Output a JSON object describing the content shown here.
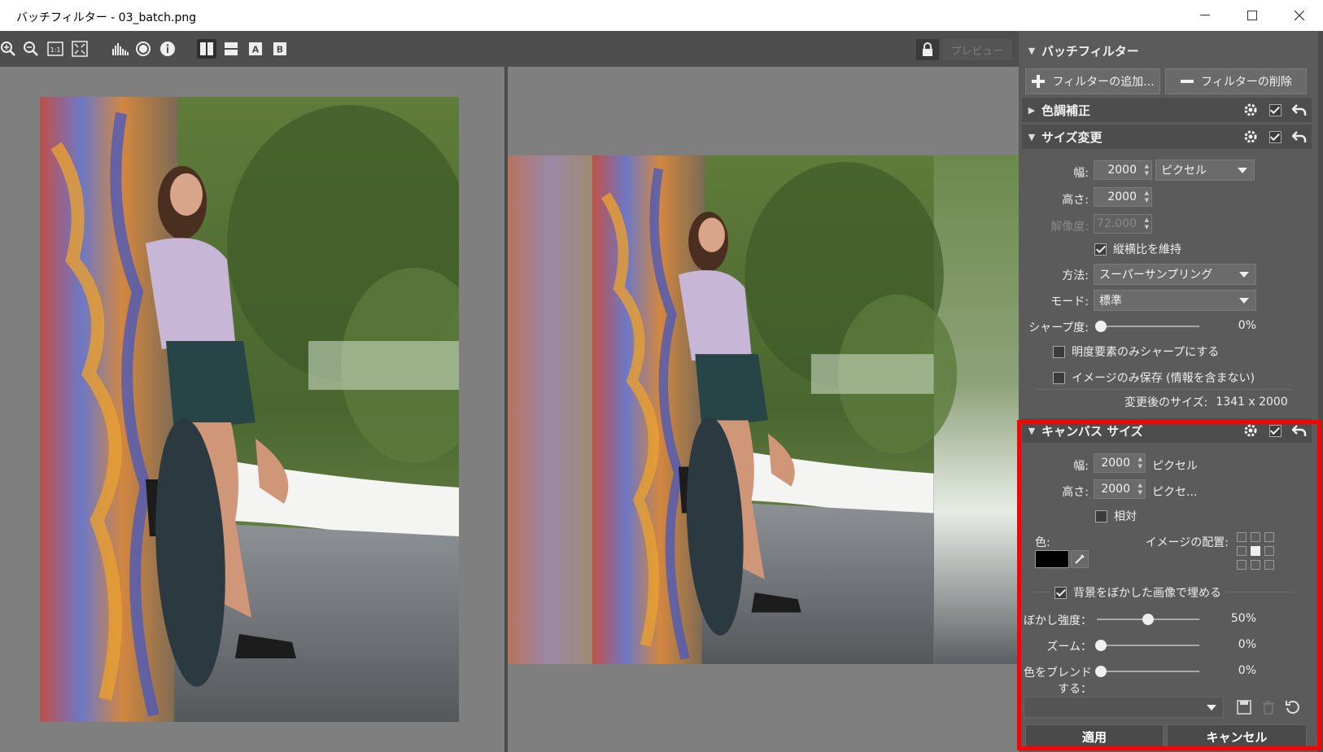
{
  "window": {
    "title": "バッチフィルター - 03_batch.png"
  },
  "toolbar": {
    "icons": [
      "zoom-in-icon",
      "zoom-out-icon",
      "actual-size-icon",
      "fit-screen-icon",
      "histogram-icon",
      "exposure-icon",
      "info-icon",
      "split-vertical-icon",
      "split-horizontal-icon",
      "view-a-icon",
      "view-b-icon"
    ],
    "view_a": "A",
    "view_b": "B",
    "actual_size": "1:1",
    "preview_label": "プレビュー"
  },
  "panel": {
    "title": "バッチフィルター",
    "add_filter": "フィルターの追加...",
    "remove_filter": "フィルターの削除",
    "color_section": "色調補正",
    "resize_section": "サイズ変更",
    "resize": {
      "width_label": "幅:",
      "width_value": "2000",
      "unit": "ピクセル",
      "height_label": "高さ:",
      "height_value": "2000",
      "resolution_label": "解像度:",
      "resolution_value": "72.000",
      "keep_aspect": "縦横比を維持",
      "method_label": "方法:",
      "method_value": "スーパーサンプリング",
      "mode_label": "モード:",
      "mode_value": "標準",
      "sharpen_label": "シャープ度:",
      "sharpen_value": "0%",
      "sharpen_luma": "明度要素のみシャープにする",
      "image_only": "イメージのみ保存 (情報を含まない)",
      "new_size_label": "変更後のサイズ:",
      "new_size_value": "1341 x 2000"
    },
    "canvas_section": "キャンバス サイズ",
    "canvas": {
      "width_label": "幅:",
      "width_value": "2000",
      "width_unit": "ピクセル",
      "height_label": "高さ:",
      "height_value": "2000",
      "height_unit": "ピクセ...",
      "relative": "相対",
      "color_label": "色:",
      "color_value": "#000000",
      "placement_label": "イメージの配置:",
      "fill_blur": "背景をぼかした画像で埋める",
      "blur_label": "ぼかし強度：",
      "blur_value": "50%",
      "zoom_label": "ズーム：",
      "zoom_value": "0%",
      "blend_label": "色をブレンドする：",
      "blend_value": "0%"
    },
    "apply": "適用",
    "cancel": "キャンセル"
  },
  "colors": {
    "highlight": "#ff0000",
    "panel_bg": "#5b5b5b",
    "pane_bg": "#7f7f7f"
  },
  "state": {
    "blur_strength": 0.5,
    "zoom": 0,
    "blend": 0,
    "sharpen": 0
  }
}
